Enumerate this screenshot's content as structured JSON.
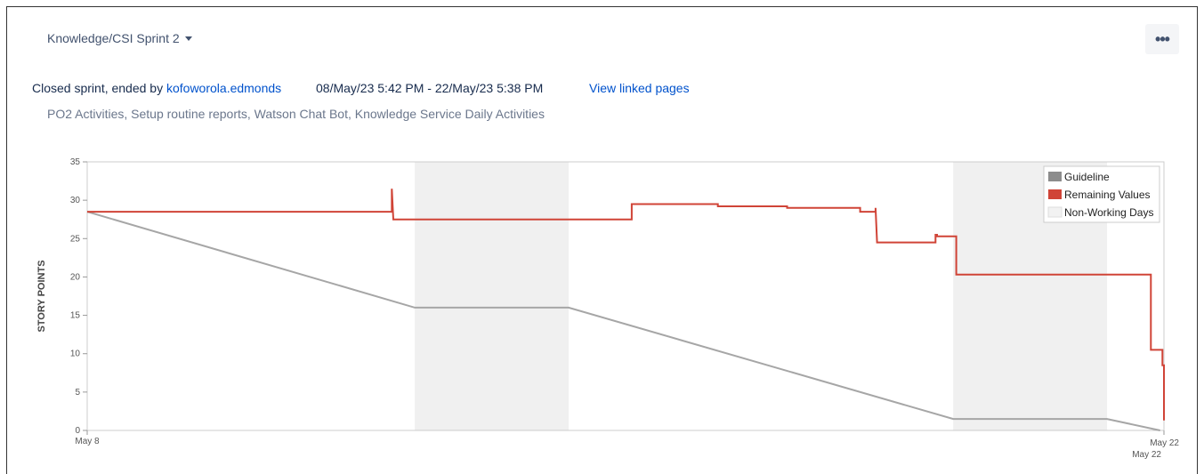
{
  "header": {
    "sprint_name": "Knowledge/CSI Sprint 2",
    "more_label": "•••"
  },
  "info": {
    "prefix": "Closed sprint, ended by ",
    "user": "kofoworola.edmonds",
    "date_range": "08/May/23 5:42 PM - 22/May/23 5:38 PM",
    "view_linked": "View linked pages",
    "linked_issues": "PO2 Activities, Setup routine reports, Watson Chat Bot, Knowledge Service Daily Activities"
  },
  "colors": {
    "guideline": "#a6a6a6",
    "remaining": "#d04437",
    "non_working": "#f0f0f0",
    "legend_non_working_swatch": "#f2f2f2",
    "legend_guideline_swatch": "#8c8c8c"
  },
  "chart_data": {
    "type": "line",
    "ylabel": "STORY POINTS",
    "ylim": [
      0,
      35
    ],
    "yticks": [
      "0",
      "5",
      "10",
      "15",
      "20",
      "25",
      "30",
      "35"
    ],
    "xlim": [
      0,
      14
    ],
    "x_tick_labels": {
      "start": "May 8",
      "end": "May 22",
      "end_secondary": "May 22"
    },
    "legend": {
      "placement": "top-right",
      "entries": [
        "Guideline",
        "Remaining Values",
        "Non-Working Days"
      ]
    },
    "non_working_days": [
      [
        4.26,
        6.26
      ],
      [
        11.26,
        13.26
      ]
    ],
    "series": [
      {
        "name": "Guideline",
        "points": [
          [
            0,
            28.5
          ],
          [
            4.26,
            16
          ],
          [
            6.26,
            16
          ],
          [
            11.26,
            1.5
          ],
          [
            13.26,
            1.5
          ],
          [
            13.95,
            0
          ]
        ]
      },
      {
        "name": "Remaining Values",
        "points": [
          [
            0,
            28.5
          ],
          [
            3.96,
            28.5
          ],
          [
            3.96,
            31.5
          ],
          [
            3.98,
            27.5
          ],
          [
            7.08,
            27.5
          ],
          [
            7.08,
            29.5
          ],
          [
            8.2,
            29.5
          ],
          [
            8.2,
            29.2
          ],
          [
            9.1,
            29.2
          ],
          [
            9.1,
            29
          ],
          [
            10.05,
            29
          ],
          [
            10.05,
            28.5
          ],
          [
            10.25,
            28.5
          ],
          [
            10.25,
            29
          ],
          [
            10.27,
            24.5
          ],
          [
            11.03,
            24.5
          ],
          [
            11.03,
            25.5
          ],
          [
            11.05,
            25.5
          ],
          [
            11.05,
            25.3
          ],
          [
            11.3,
            25.3
          ],
          [
            11.3,
            20.3
          ],
          [
            13.83,
            20.3
          ],
          [
            13.83,
            10.5
          ],
          [
            13.98,
            10.5
          ],
          [
            13.98,
            8.5
          ],
          [
            14,
            8.5
          ],
          [
            14,
            1.3
          ]
        ]
      }
    ]
  }
}
